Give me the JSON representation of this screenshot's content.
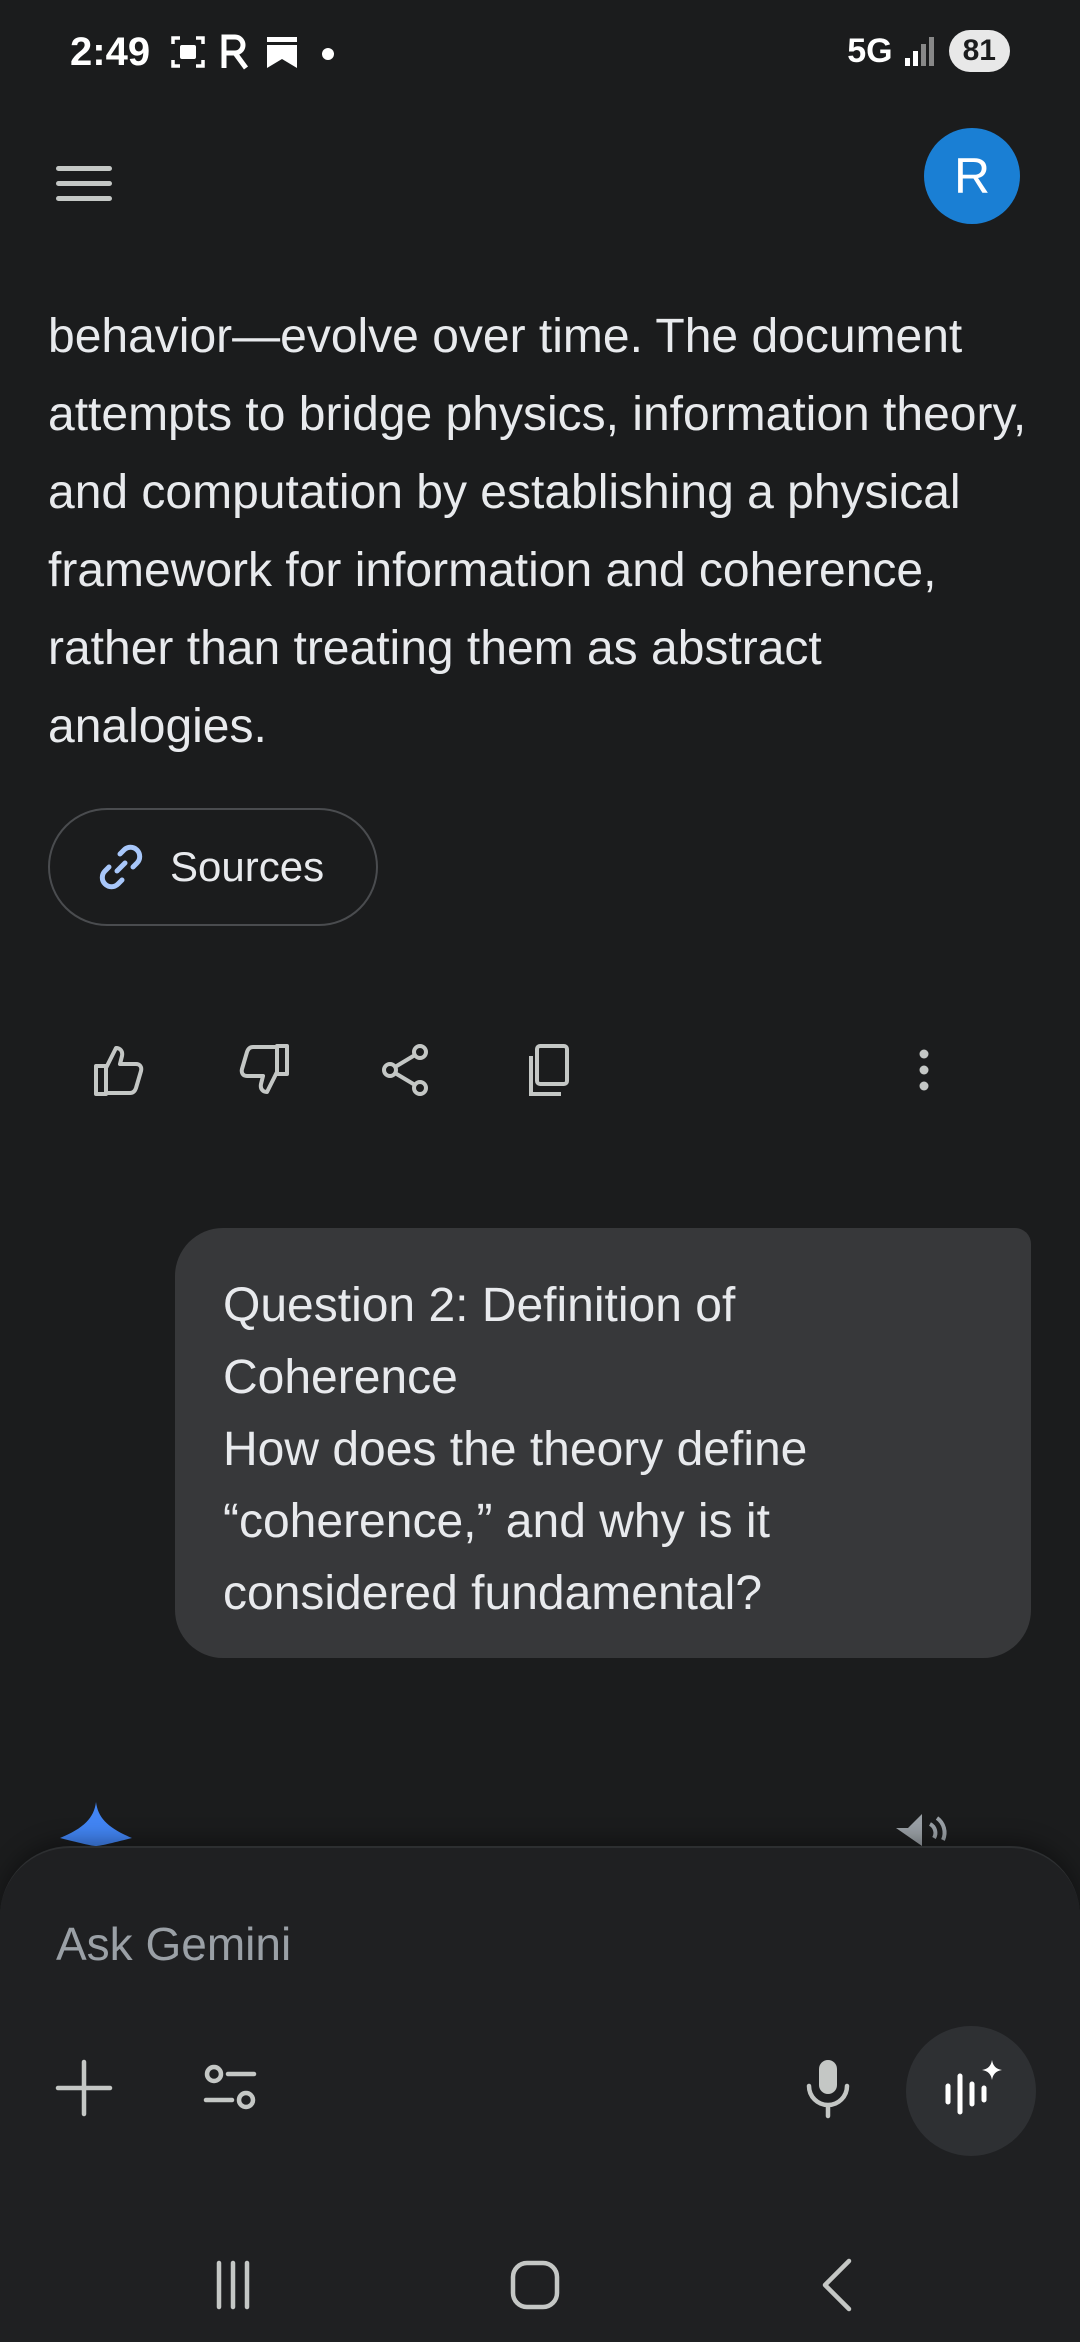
{
  "status_bar": {
    "time": "2:49",
    "network": "5G",
    "battery": "81",
    "icons": [
      "screenshot-icon",
      "r-app-icon",
      "bookmark-icon",
      "notification-dot-icon"
    ]
  },
  "header": {
    "menu_icon": "hamburger-menu-icon",
    "avatar_letter": "R",
    "avatar_color": "#1a7fd4"
  },
  "response": {
    "text": "behavior—evolve over time. The document attempts to bridge physics, information theory, and computation by establishing a physical framework for information and coherence, rather than treating them as abstract analogies.",
    "sources_label": "Sources",
    "actions": [
      "thumbs-up-icon",
      "thumbs-down-icon",
      "share-icon",
      "copy-icon",
      "more-options-icon"
    ]
  },
  "user_message": {
    "line1": "Question 2: Definition of Coherence",
    "line2": "How does the theory define “coherence,” and why is it considered fundamental?"
  },
  "composer": {
    "placeholder": "Ask Gemini",
    "accent_color": "#4285f4"
  },
  "system_nav": [
    "recent-apps-icon",
    "home-icon",
    "back-icon"
  ]
}
